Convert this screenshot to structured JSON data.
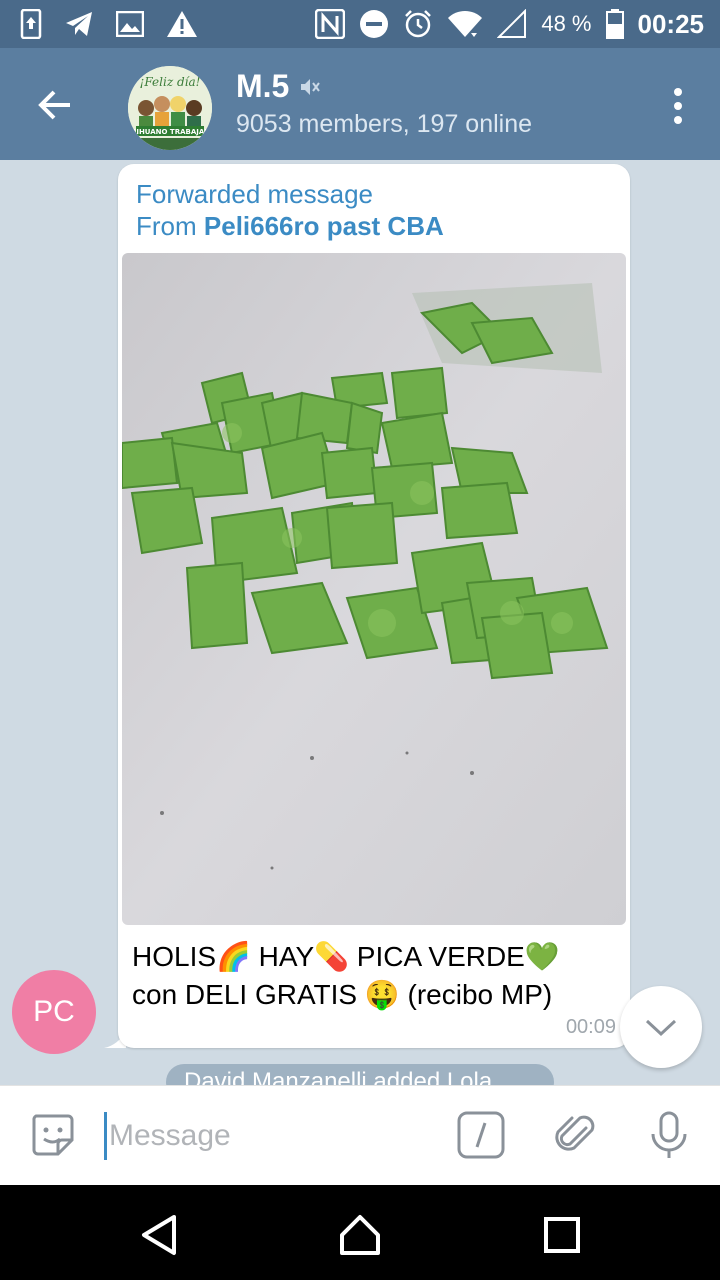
{
  "status_bar": {
    "battery_percent": "48 %",
    "time": "00:25"
  },
  "app_bar": {
    "avatar_text": "¡Feliz día!",
    "avatar_text2": "MARIHUANO TRABAJADOR",
    "title": "M.5",
    "subtitle": "9053 members, 197 online"
  },
  "message": {
    "forwarded_label": "Forwarded message",
    "from_prefix": "From ",
    "from_name": "Peli666ro past CBA",
    "text_line1": "HOLIS🌈 HAY💊 PICA VERDE💚",
    "text_line2": "con DELI GRATIS 🤑 (recibo MP)",
    "time": "00:09",
    "sender_initials": "PC"
  },
  "service_message": "David Manzanelli added Lola",
  "input": {
    "placeholder": "Message"
  },
  "colors": {
    "header": "#5b7ea0",
    "status_bar": "#4a6a8a",
    "link_blue": "#3b8bc4",
    "avatar_pink": "#f07ea5"
  },
  "icons": {
    "back": "arrow-left-icon",
    "menu": "more-vertical-icon",
    "mute": "muted-speaker-icon",
    "sticker": "sticker-icon",
    "command": "slash-command-icon",
    "attach": "paperclip-icon",
    "mic": "microphone-icon",
    "scroll": "chevron-down-icon"
  }
}
